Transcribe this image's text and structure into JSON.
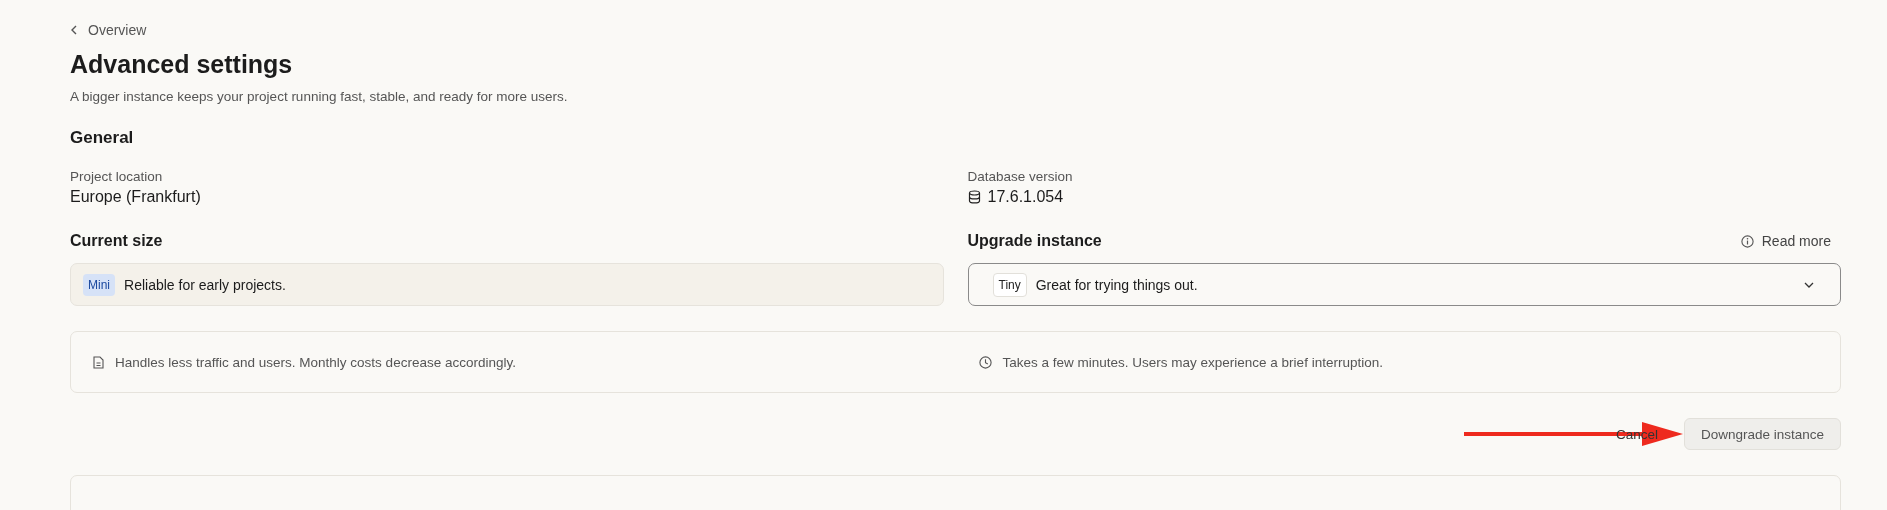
{
  "breadcrumb": {
    "label": "Overview"
  },
  "title": "Advanced settings",
  "subtitle": "A bigger instance keeps your project running fast, stable, and ready for more users.",
  "general": {
    "heading": "General",
    "fields": [
      {
        "label": "Project location",
        "value": "Europe (Frankfurt)",
        "kind": "text"
      },
      {
        "label": "Database version",
        "value": "17.6.1.054",
        "kind": "database"
      }
    ]
  },
  "current_size": {
    "heading": "Current size",
    "tier": "Mini",
    "description": "Reliable for early projects."
  },
  "upgrade_instance": {
    "heading": "Upgrade instance",
    "read_more": "Read more",
    "tier": "Tiny",
    "description": "Great for trying things out."
  },
  "notes": [
    {
      "kind": "document",
      "text": "Handles less traffic and users. Monthly costs decrease accordingly."
    },
    {
      "kind": "clock",
      "text": "Takes a few minutes. Users may experience a brief interruption."
    }
  ],
  "actions": {
    "cancel": "Cancel",
    "confirm": "Downgrade instance"
  }
}
